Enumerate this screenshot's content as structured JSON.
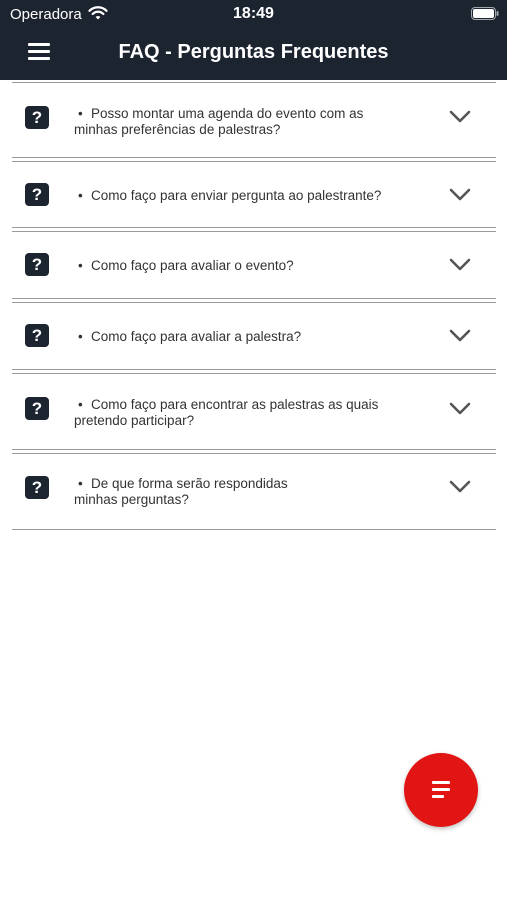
{
  "status_bar": {
    "carrier": "Operadora",
    "time": "18:49"
  },
  "header": {
    "title": "FAQ - Perguntas Frequentes",
    "menu_icon": "hamburger-menu-icon"
  },
  "faq": {
    "icon_glyph": "?",
    "items": [
      {
        "bullet": "•",
        "line1": "Posso montar uma agenda do evento com as",
        "line2": "minhas preferências de palestras?"
      },
      {
        "bullet": "•",
        "line1": "Como faço para enviar pergunta ao palestrante?",
        "line2": ""
      },
      {
        "bullet": "•",
        "line1": "Como faço para avaliar o evento?",
        "line2": ""
      },
      {
        "bullet": "•",
        "line1": "Como faço para avaliar a palestra?",
        "line2": ""
      },
      {
        "bullet": "•",
        "line1": "Como faço para encontrar as palestras as quais",
        "line2": "pretendo participar?"
      },
      {
        "bullet": "•",
        "line1": "De que forma serão respondidas",
        "line2": "minhas perguntas?"
      }
    ]
  },
  "fab": {
    "icon": "list-menu-icon"
  },
  "colors": {
    "header_bg": "#1c2430",
    "fab_bg": "#e21515",
    "divider": "#9a9a9a"
  }
}
